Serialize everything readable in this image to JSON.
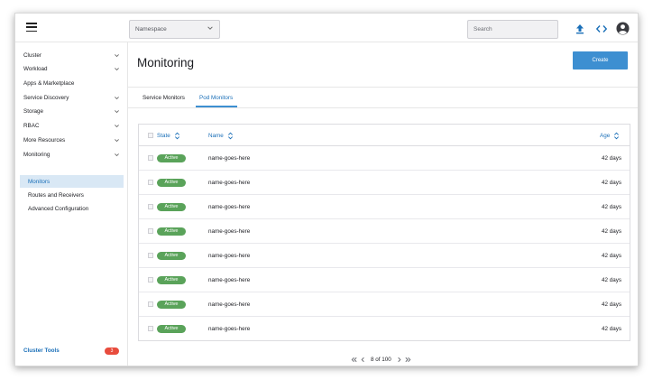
{
  "header": {
    "namespace_label": "Namespace",
    "search_placeholder": "Search"
  },
  "sidebar": {
    "items": [
      {
        "label": "Cluster",
        "expandable": true
      },
      {
        "label": "Workload",
        "expandable": true
      },
      {
        "label": "Apps & Marketplace",
        "expandable": false
      },
      {
        "label": "Service Discovery",
        "expandable": true
      },
      {
        "label": "Storage",
        "expandable": true
      },
      {
        "label": "RBAC",
        "expandable": true
      },
      {
        "label": "More Resources",
        "expandable": true
      },
      {
        "label": "Monitoring",
        "expandable": true,
        "expanded": true
      }
    ],
    "sub_items": [
      {
        "label": "Monitors",
        "active": true
      },
      {
        "label": "Routes and Receivers",
        "active": false
      },
      {
        "label": "Advanced Configuration",
        "active": false
      }
    ],
    "footer": {
      "label": "Cluster Tools",
      "badge": "3"
    }
  },
  "main": {
    "title": "Monitoring",
    "create_label": "Create",
    "tabs": [
      {
        "label": "Service Monitors",
        "active": false
      },
      {
        "label": "Pod Monitors",
        "active": true
      }
    ],
    "table": {
      "columns": [
        "State",
        "Name",
        "Age"
      ],
      "rows": [
        {
          "state": "Active",
          "name": "name-goes-here",
          "age": "42 days"
        },
        {
          "state": "Active",
          "name": "name-goes-here",
          "age": "42 days"
        },
        {
          "state": "Active",
          "name": "name-goes-here",
          "age": "42 days"
        },
        {
          "state": "Active",
          "name": "name-goes-here",
          "age": "42 days"
        },
        {
          "state": "Active",
          "name": "name-goes-here",
          "age": "42 days"
        },
        {
          "state": "Active",
          "name": "name-goes-here",
          "age": "42 days"
        },
        {
          "state": "Active",
          "name": "name-goes-here",
          "age": "42 days"
        },
        {
          "state": "Active",
          "name": "name-goes-here",
          "age": "42 days"
        }
      ]
    },
    "pagination": {
      "text": "8 of 100"
    }
  },
  "colors": {
    "accent": "#3d8fd1",
    "link": "#1a6fb8",
    "active_badge": "#5aa35a",
    "count_badge": "#e84c3d",
    "selected_nav_bg": "#d9e8f5"
  },
  "icons": [
    "hamburger-icon",
    "chevron-down-icon",
    "upload-icon",
    "code-icon",
    "user-avatar-icon",
    "sort-icon",
    "first-page-icon",
    "prev-page-icon",
    "next-page-icon",
    "last-page-icon"
  ]
}
